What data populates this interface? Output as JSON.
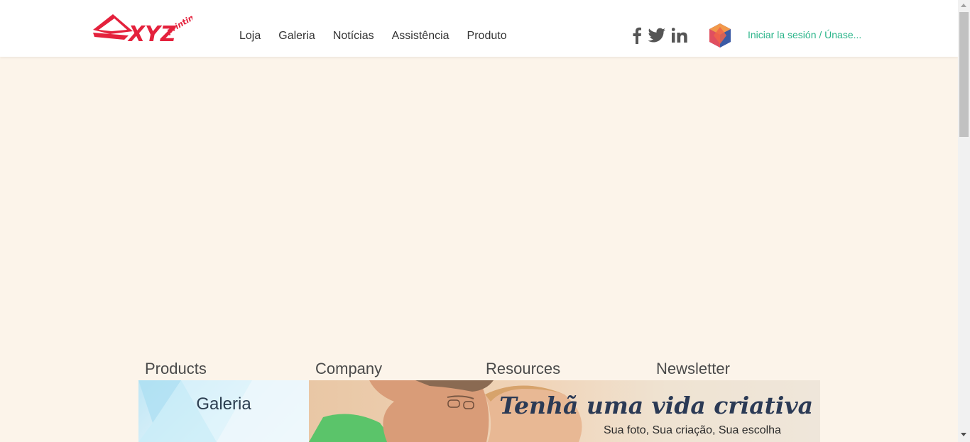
{
  "brand": {
    "logo_text": "XYZ",
    "logo_sub": "printing",
    "brand_color": "#e4213c"
  },
  "nav": {
    "items": [
      {
        "label": "Loja"
      },
      {
        "label": "Galeria"
      },
      {
        "label": "Notícias"
      },
      {
        "label": "Assistência"
      },
      {
        "label": "Produto"
      }
    ]
  },
  "social": {
    "icons": [
      "facebook-icon",
      "twitter-icon",
      "linkedin-icon"
    ],
    "icon_color": "#555555"
  },
  "account": {
    "login_label": "Iniciar la sesión / Únase...",
    "link_color": "#2bb58a"
  },
  "sections_peek": [
    "Products",
    "Company",
    "Resources",
    "Newsletter"
  ],
  "banner": {
    "gallery_title": "Galeria",
    "headline": "Tenhã uma vida criativa",
    "subheadline": "Sua foto, Sua criação, Sua escolha"
  },
  "colors": {
    "page_background": "#fcf4ea",
    "header_background": "#ffffff"
  }
}
